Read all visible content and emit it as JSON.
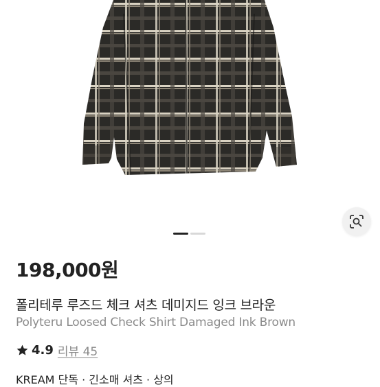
{
  "product": {
    "price": "198,000원",
    "title_ko": "폴리테루 루즈드 체크 셔츠 데미지드 잉크 브라운",
    "title_en": "Polyteru Loosed Check Shirt Damaged Ink Brown",
    "rating": "4.9",
    "review_label": "리뷰 45",
    "breadcrumb": "KREAM 단독 · 긴소매 셔츠 · 상의"
  },
  "image": {
    "description_icon": "plaid-shirt-image",
    "slide_count": 2,
    "active_slide": 1
  },
  "icons": {
    "lens": "lens-search-icon",
    "star": "star-icon"
  },
  "colors": {
    "accent": "#222222",
    "muted": "#8a8a8a",
    "shirt_base": "#2b2a27",
    "plaid_light": "#cfc6b4"
  }
}
